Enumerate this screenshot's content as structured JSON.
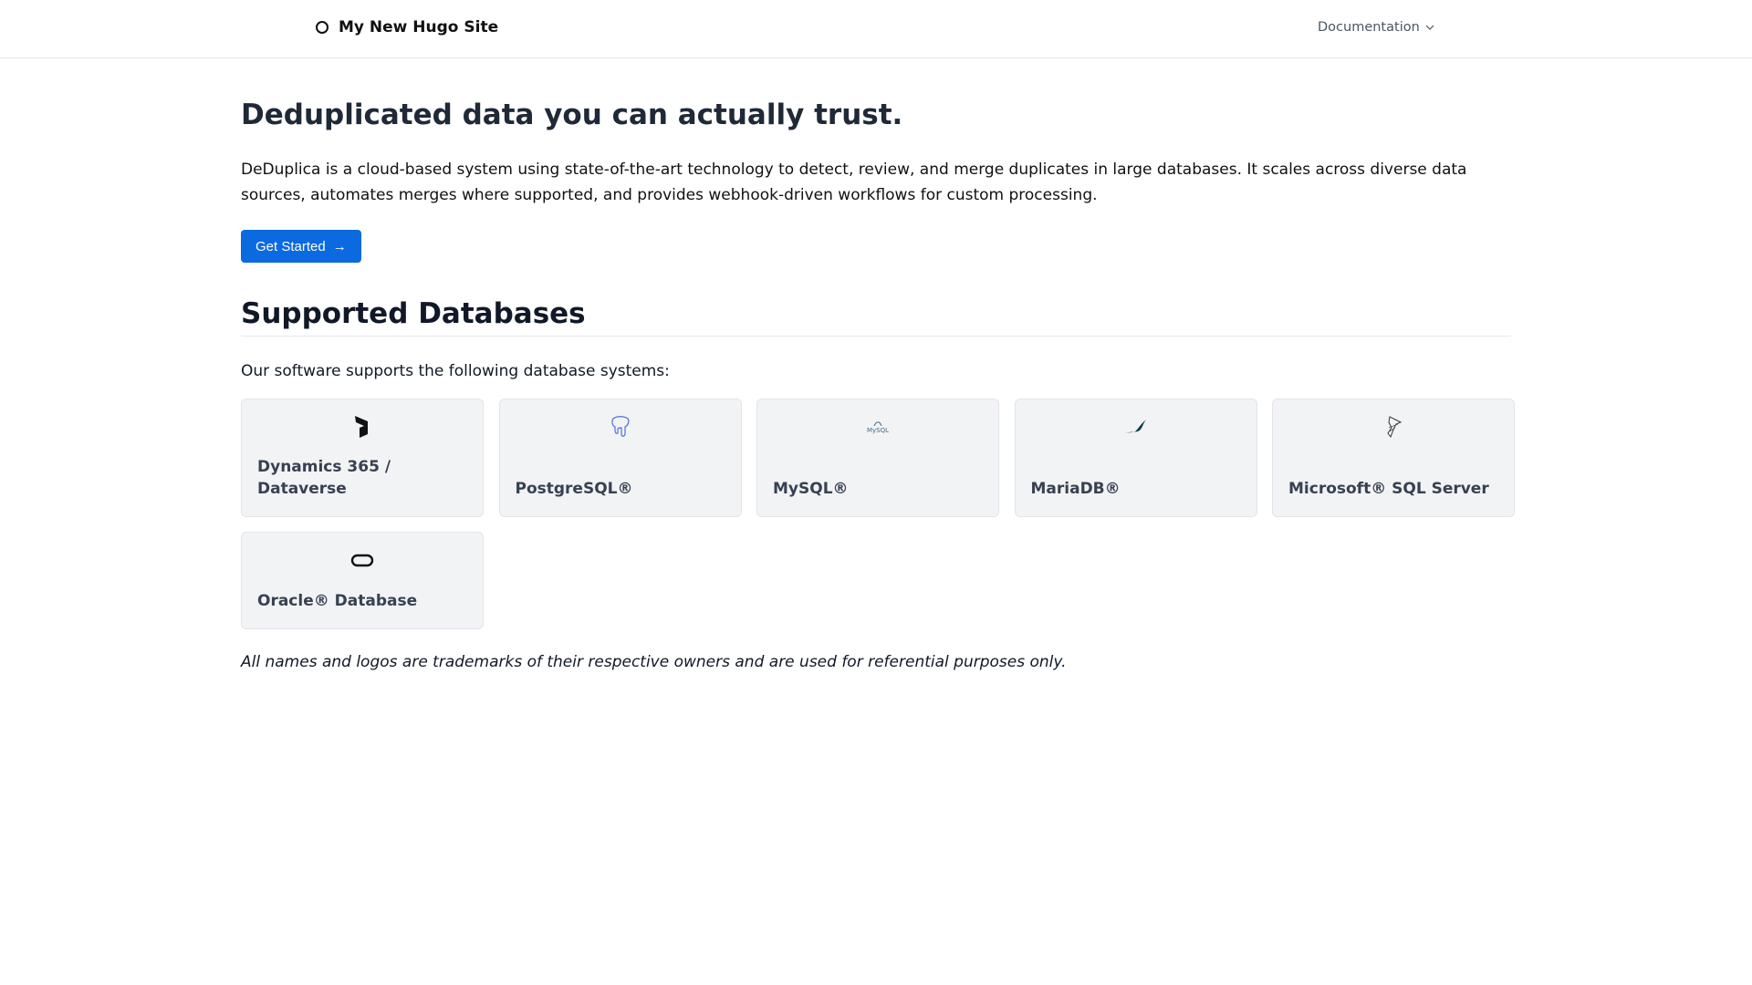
{
  "header": {
    "site_title": "My New Hugo Site",
    "nav_documentation": "Documentation"
  },
  "hero": {
    "title": "Deduplicated data you can actually trust.",
    "description": "DeDuplica is a cloud-based system using state-of-the-art technology to detect, review, and merge duplicates in large databases. It scales across diverse data sources, automates merges where supported, and provides webhook-driven workflows for custom processing.",
    "cta_label": "Get Started",
    "cta_arrow": "→"
  },
  "databases": {
    "title": "Supported Databases",
    "intro": "Our software supports the following database systems:",
    "items": [
      {
        "label": "Dynamics 365 / Dataverse",
        "icon": "dynamics-icon"
      },
      {
        "label": "PostgreSQL®",
        "icon": "postgresql-icon"
      },
      {
        "label": "MySQL®",
        "icon": "mysql-icon",
        "logo_text": "MySQL"
      },
      {
        "label": "MariaDB®",
        "icon": "mariadb-icon"
      },
      {
        "label": "Microsoft® SQL Server",
        "icon": "sql-server-icon"
      },
      {
        "label": "Oracle® Database",
        "icon": "oracle-icon"
      }
    ],
    "note": "All names and logos are trademarks of their respective owners and are used for referential purposes only."
  }
}
